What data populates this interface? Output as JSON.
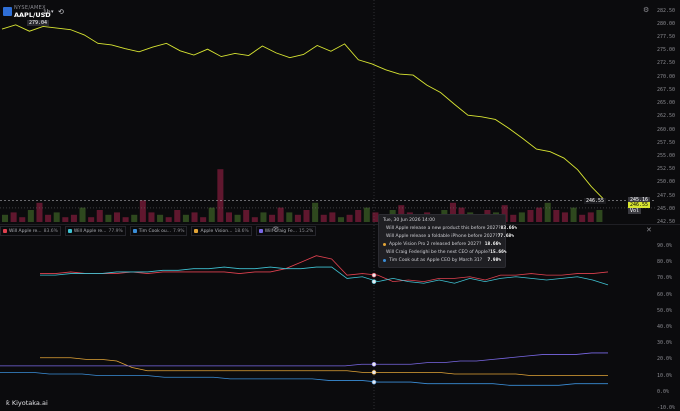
{
  "header": {
    "venue": "NYSE/AMEX",
    "ticker": "AAPL/USD",
    "interval": "1h",
    "chevron_glyph": "▾",
    "reset_glyph": "⟲",
    "price_tag": "279.04",
    "settings_glyph": "⚙"
  },
  "price_axis": {
    "ticks": [
      "282.50",
      "280.00",
      "277.50",
      "275.00",
      "272.50",
      "270.00",
      "267.50",
      "265.00",
      "262.50",
      "260.00",
      "257.50",
      "255.00",
      "252.50",
      "250.00",
      "247.50",
      "245.00",
      "242.50"
    ],
    "current_price": "246.55",
    "current_price_badge": "246.55",
    "secondary_badge": "245.16",
    "extra_badge": "Vol"
  },
  "colors": {
    "price_line": "#d8e532",
    "vol_red": "#a8224a",
    "vol_green": "#4d7b2e",
    "s1": "#e0414f",
    "s2": "#3fc3d3",
    "s3": "#e2a437",
    "s4": "#7a68e6",
    "s5": "#3b8ed8"
  },
  "legend": [
    {
      "label": "Will Apple re...",
      "value": "83.6%",
      "color": "#e0414f"
    },
    {
      "label": "Will Apple re...",
      "value": "77.9%",
      "color": "#3fc3d3"
    },
    {
      "label": "Tim Cook ou...",
      "value": "7.9%",
      "color": "#3b8ed8"
    },
    {
      "label": "Apple Vision...",
      "value": "18.6%",
      "color": "#e2a437"
    },
    {
      "label": "Will Craig Fe...",
      "value": "15.2%",
      "color": "#7a68e6"
    }
  ],
  "legend_eye": "👁",
  "close_glyph": "✕",
  "pm_axis": [
    "90.0%",
    "80.0%",
    "70.0%",
    "60.0%",
    "50.0%",
    "40.0%",
    "30.0%",
    "20.0%",
    "10.0%",
    "0.0%",
    "-10.0%"
  ],
  "tooltip": {
    "title": "Tue, 30 Jun 2026 14:00",
    "rows": [
      {
        "label": "Will Apple release a new product this before 2027?",
        "value": "83.66%",
        "color": "#e0414f"
      },
      {
        "label": "Will Apple release a foldable iPhone before 2027?",
        "value": "77.68%",
        "color": "#3fc3d3"
      },
      {
        "label": "Apple Vision Pro 2 released before 2027?",
        "value": "18.66%",
        "color": "#e2a437"
      },
      {
        "label": "Will Craig Federighi be the next CEO of Apple?",
        "value": "15.66%",
        "color": "#7a68e6"
      },
      {
        "label": "Tim Cook out as Apple CEO by March 31?",
        "value": "7.98%",
        "color": "#3b8ed8"
      }
    ]
  },
  "brand": "Kiyotaka.ai",
  "brand_glyph": "ƙ",
  "chart_data": {
    "type": "line",
    "title": "",
    "price": {
      "ylim": [
        242.5,
        283.75
      ],
      "series": [
        {
          "name": "AAPL/USD",
          "values": [
            279.0,
            279.8,
            278.6,
            279.5,
            279.2,
            278.9,
            277.9,
            276.3,
            276.0,
            275.3,
            274.7,
            275.6,
            276.3,
            274.9,
            274.1,
            275.2,
            273.8,
            274.4,
            274.0,
            275.8,
            274.5,
            273.6,
            274.2,
            275.9,
            274.8,
            276.2,
            273.2,
            272.4,
            271.3,
            270.5,
            270.3,
            268.4,
            267.0,
            264.8,
            262.7,
            262.4,
            261.9,
            260.2,
            258.3,
            256.3,
            255.8,
            254.6,
            252.4,
            249.2,
            246.55
          ]
        }
      ]
    },
    "prediction": {
      "ylim": [
        -10,
        90
      ],
      "series": [
        {
          "name": "Will Apple release a new product this before 2027?",
          "values": [
            73,
            73,
            74,
            73,
            73,
            73,
            74,
            73,
            74,
            74,
            74,
            74,
            74,
            73,
            74,
            74,
            76,
            80,
            84,
            82,
            72,
            73,
            72,
            68,
            69,
            68,
            70,
            70,
            71,
            69,
            72,
            72,
            73,
            72,
            72,
            73,
            73,
            74
          ]
        },
        {
          "name": "Will Apple release a foldable iPhone before 2027?",
          "values": [
            72,
            72,
            73,
            73,
            73,
            74,
            74,
            74,
            75,
            75,
            76,
            76,
            77,
            76,
            76,
            77,
            76,
            76,
            77,
            77,
            70,
            71,
            68,
            70,
            68,
            67,
            69,
            67,
            70,
            68,
            70,
            71,
            70,
            69,
            70,
            71,
            69,
            66
          ]
        },
        {
          "name": "Apple Vision Pro 2 released before 2027?",
          "values": [
            21,
            21,
            21,
            20,
            20,
            19,
            15,
            13,
            13,
            13,
            13,
            13,
            13,
            13,
            13,
            13,
            13,
            13,
            13,
            13,
            13,
            12,
            12,
            12,
            12,
            12,
            12,
            11,
            11,
            11,
            11,
            11,
            10,
            10,
            10,
            10,
            10,
            10
          ]
        },
        {
          "name": "Will Craig Federighi be the next CEO of Apple?",
          "values": [
            16,
            16,
            16,
            16,
            16,
            16,
            16,
            16,
            16,
            16,
            16,
            16,
            16,
            16,
            16,
            16,
            16,
            16,
            16,
            16,
            16,
            16,
            17,
            17,
            17,
            17,
            18,
            18,
            19,
            19,
            20,
            21,
            22,
            23,
            23,
            23,
            24,
            24
          ]
        },
        {
          "name": "Tim Cook out as Apple CEO by March 31?",
          "values": [
            12,
            12,
            12,
            11,
            11,
            11,
            10,
            10,
            10,
            10,
            9,
            9,
            9,
            9,
            8,
            8,
            8,
            8,
            8,
            8,
            7,
            7,
            7,
            6,
            6,
            6,
            5,
            5,
            5,
            5,
            5,
            4,
            4,
            4,
            4,
            5,
            5,
            5
          ]
        }
      ]
    },
    "volume": {
      "values": [
        3,
        4,
        2,
        5,
        8,
        3,
        4,
        2,
        3,
        6,
        2,
        5,
        3,
        4,
        2,
        3,
        9,
        4,
        3,
        2,
        5,
        3,
        4,
        2,
        6,
        22,
        4,
        3,
        5,
        2,
        4,
        3,
        6,
        4,
        3,
        5,
        8,
        3,
        4,
        2,
        3,
        5,
        6,
        4,
        3,
        5,
        7,
        4,
        2,
        4,
        3,
        5,
        8,
        6,
        4,
        3,
        5,
        4,
        7,
        3,
        4,
        5,
        6,
        8,
        5,
        4,
        6,
        3,
        4,
        5
      ]
    }
  }
}
